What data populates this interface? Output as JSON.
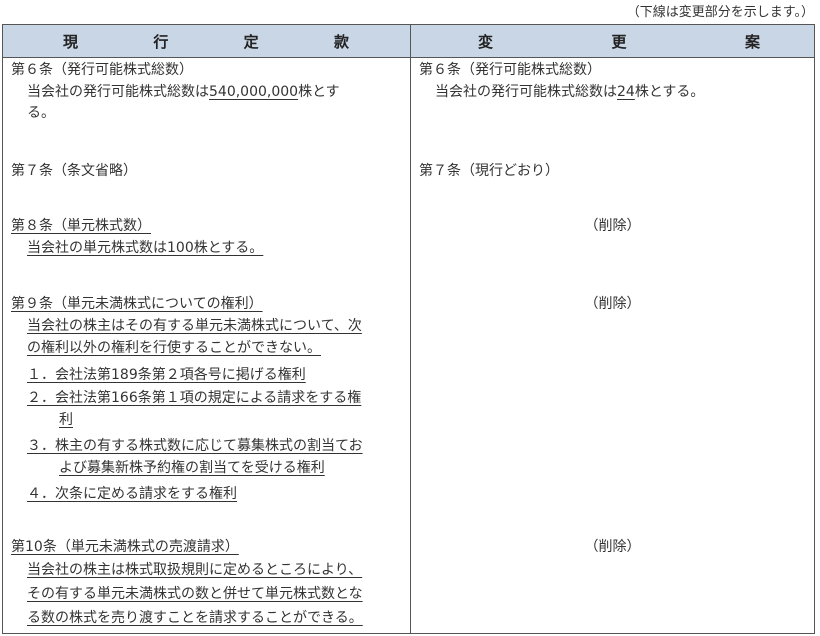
{
  "note": "（下線は変更部分を示します。）",
  "header": {
    "left_chars": [
      "現",
      "行",
      "定",
      "款"
    ],
    "right_chars": [
      "変",
      "更",
      "案"
    ]
  },
  "current": {
    "art6": {
      "title": "第６条（発行可能株式総数）",
      "line1_pre": "当会社の発行可能株式総数は",
      "line1_num": "540,000,000",
      "line1_post": "株とす",
      "line2": "る。"
    },
    "art7": {
      "title": "第７条（条文省略）"
    },
    "art8": {
      "title": "第８条（単元株式数）",
      "body": "当会社の単元株式数は100株とする。"
    },
    "art9": {
      "title": "第９条（単元未満株式についての権利）",
      "body1": "当会社の株主はその有する単元未満株式について、次",
      "body2": "の権利以外の権利を行使することができない。",
      "item1": "１．会社法第189条第２項各号に掲げる権利",
      "item2a": "２．会社法第166条第１項の規定による請求をする権",
      "item2b": "利",
      "item3a": "３．株主の有する株式数に応じて募集株式の割当てお",
      "item3b": "よび募集新株予約権の割当てを受ける権利",
      "item4": "４．次条に定める請求をする権利"
    },
    "art10": {
      "title": "第10条（単元未満株式の売渡請求）",
      "body1": "当会社の株主は株式取扱規則に定めるところにより、",
      "body2": "その有する単元未満株式の数と併せて単元株式数とな",
      "body3": "る数の株式を売り渡すことを請求することができる。"
    }
  },
  "proposed": {
    "art6": {
      "title": "第６条（発行可能株式総数）",
      "line1_pre": "当会社の発行可能株式総数は",
      "line1_num": "24",
      "line1_post": "株とする。"
    },
    "art7": {
      "title": "第７条（現行どおり）"
    },
    "deleted": "（削除）"
  }
}
